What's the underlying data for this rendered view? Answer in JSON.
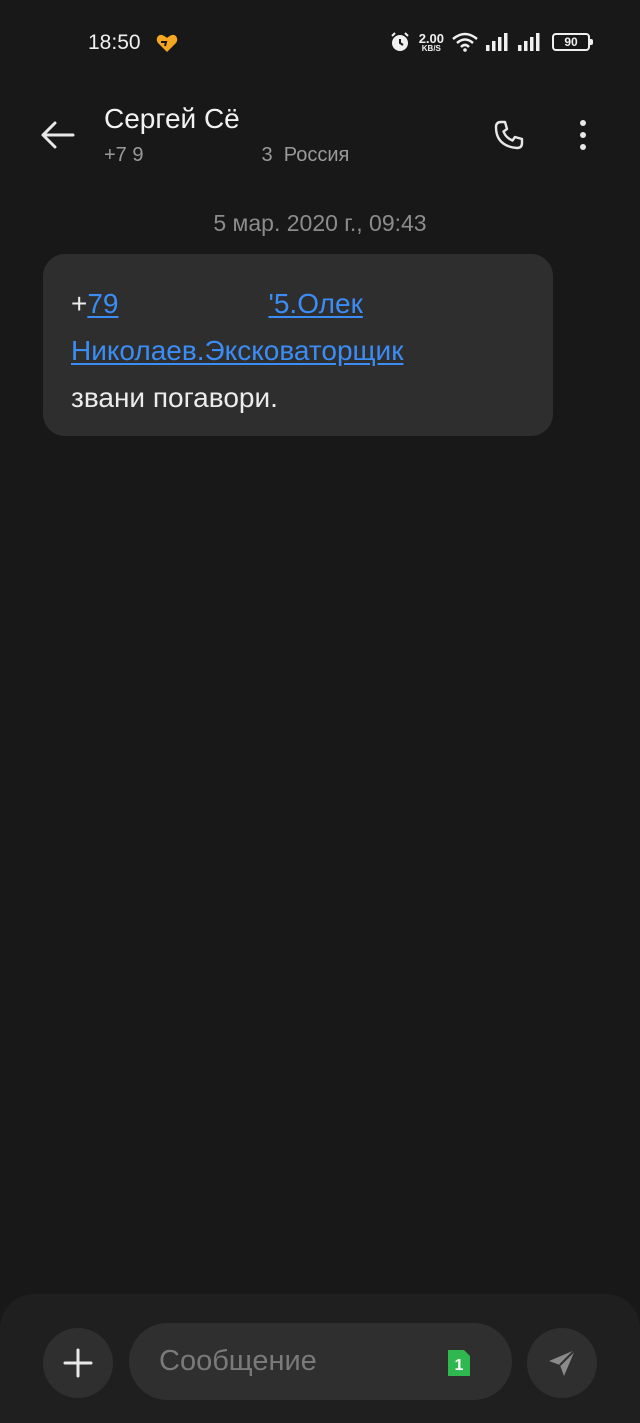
{
  "status_bar": {
    "time": "18:50",
    "net_speed_value": "2.00",
    "net_speed_unit": "KB/S",
    "battery": "90",
    "icons": [
      "heart-icon",
      "alarm-icon",
      "wifi-icon",
      "signal-icon",
      "signal-icon",
      "battery-icon"
    ]
  },
  "header": {
    "contact_name": "Сергей Сё",
    "phone_prefix": "+7 9",
    "phone_suffix": "3",
    "country": "Россия",
    "icons": [
      "back-arrow-icon",
      "phone-icon",
      "more-vertical-icon"
    ]
  },
  "conversation": {
    "date_separator": "5 мар. 2020 г., 09:43",
    "message": {
      "plus": "+",
      "link_part1": "79",
      "link_part2": "'5.Олек",
      "link_line2": "Николаев.Эксковаторщик",
      "text_line3": "звани погавори."
    }
  },
  "composer": {
    "placeholder": "Сообщение",
    "sim_number": "1",
    "icons": [
      "plus-icon",
      "sim-icon",
      "send-icon"
    ]
  },
  "colors": {
    "background": "#181818",
    "bubble": "#2e2e2e",
    "link": "#3b8df5",
    "sim_badge": "#2fb84f",
    "heart": "#f5a623"
  }
}
